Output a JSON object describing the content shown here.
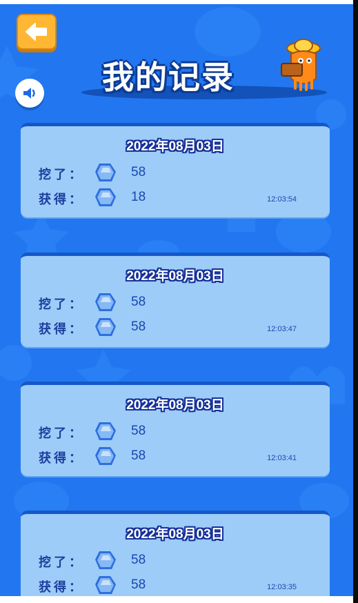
{
  "header": {
    "title": "我的记录",
    "back_icon": "arrow-left-icon",
    "sound_icon": "speaker-icon"
  },
  "colors": {
    "background": "#2277f0",
    "card": "#9dccf8",
    "accent": "#ffb733",
    "text": "#1c3f9e"
  },
  "records": [
    {
      "date": "2022年08月03日",
      "dug_label": "挖了：",
      "dug_value": "58",
      "earned_label": "获得：",
      "earned_value": "18",
      "time": "12:03:54"
    },
    {
      "date": "2022年08月03日",
      "dug_label": "挖了：",
      "dug_value": "58",
      "earned_label": "获得：",
      "earned_value": "58",
      "time": "12:03:47"
    },
    {
      "date": "2022年08月03日",
      "dug_label": "挖了：",
      "dug_value": "58",
      "earned_label": "获得：",
      "earned_value": "58",
      "time": "12:03:41"
    },
    {
      "date": "2022年08月03日",
      "dug_label": "挖了：",
      "dug_value": "58",
      "earned_label": "获得：",
      "earned_value": "58",
      "time": "12:03:35"
    }
  ]
}
